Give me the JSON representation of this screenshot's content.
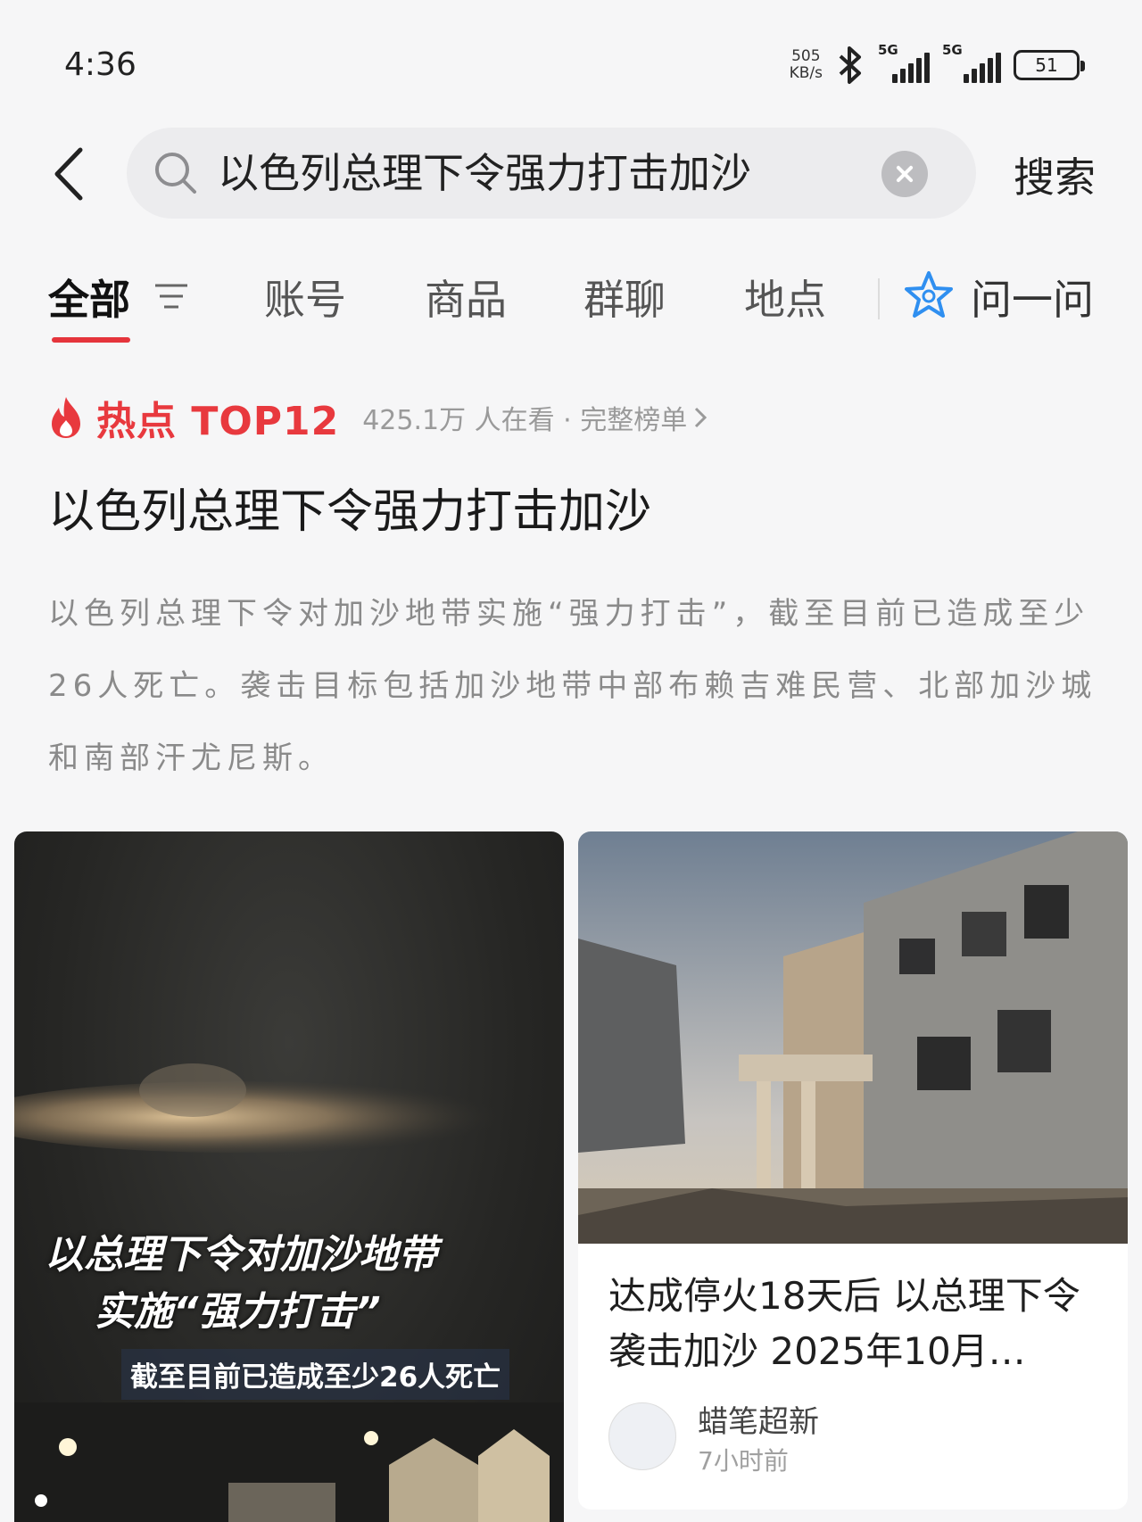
{
  "status_bar": {
    "time": "4:36",
    "net_speed_value": "505",
    "net_speed_unit": "KB/s",
    "signal1_label": "5G",
    "signal2_label": "5G",
    "battery": "51"
  },
  "search": {
    "back_icon": "chevron-left-icon",
    "query": "以色列总理下令强力打击加沙",
    "submit_label": "搜索"
  },
  "tabs": {
    "items": [
      "全部",
      "账号",
      "商品",
      "群聊",
      "地点"
    ],
    "ask_label": "问一问"
  },
  "hot": {
    "label": "热点 TOP12",
    "meta": "425.1万 人在看 · 完整榜单",
    "accent_color": "#e8393e"
  },
  "topic": {
    "title": "以色列总理下令强力打击加沙",
    "description": "以色列总理下令对加沙地带实施“强力打击”，截至目前已造成至少26人死亡。袭击目标包括加沙地带中部布赖吉难民营、北部加沙城和南部汗尤尼斯。"
  },
  "cards": {
    "left": {
      "overlay_line1": "以总理下令对加沙地带",
      "overlay_line2": "实施“强力打击”",
      "overlay_sub": "截至目前已造成至少26人死亡"
    },
    "right": {
      "title": "达成停火18天后 以总理下令袭击加沙 2025年10月…",
      "author": "蜡笔超新",
      "time": "7小时前"
    }
  }
}
